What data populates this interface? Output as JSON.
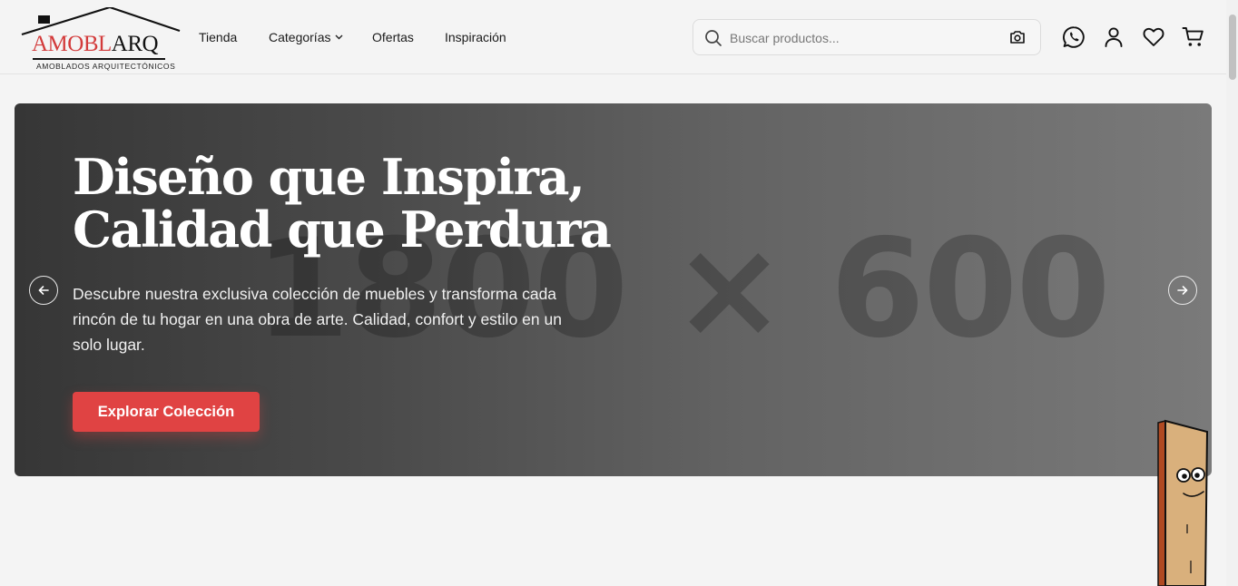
{
  "header": {
    "logo": {
      "word_left": "AMOBL",
      "word_right": "ARQ",
      "tagline": "AMOBLADOS ARQUITECTÓNICOS"
    },
    "nav": [
      {
        "label": "Tienda"
      },
      {
        "label": "Categorías",
        "has_dropdown": true
      },
      {
        "label": "Ofertas"
      },
      {
        "label": "Inspiración"
      }
    ],
    "search": {
      "placeholder": "Buscar productos...",
      "value": ""
    },
    "icons": [
      "whatsapp-icon",
      "user-icon",
      "heart-icon",
      "cart-icon"
    ]
  },
  "hero": {
    "placeholder_text": "1800 × 600",
    "title_line1": "Diseño que Inspira,",
    "title_line2": "Calidad que Perdura",
    "description": "Descubre nuestra exclusiva colección de muebles y transforma cada rincón de tu hogar en una obra de arte. Calidad, confort y estilo en un solo lugar.",
    "cta_label": "Explorar Colección"
  },
  "colors": {
    "accent": "#e04343",
    "logo_red": "#d33b3b",
    "page_bg": "#f4f4f4",
    "hero_dark": "#363636",
    "hero_light": "#7a7a7a"
  }
}
